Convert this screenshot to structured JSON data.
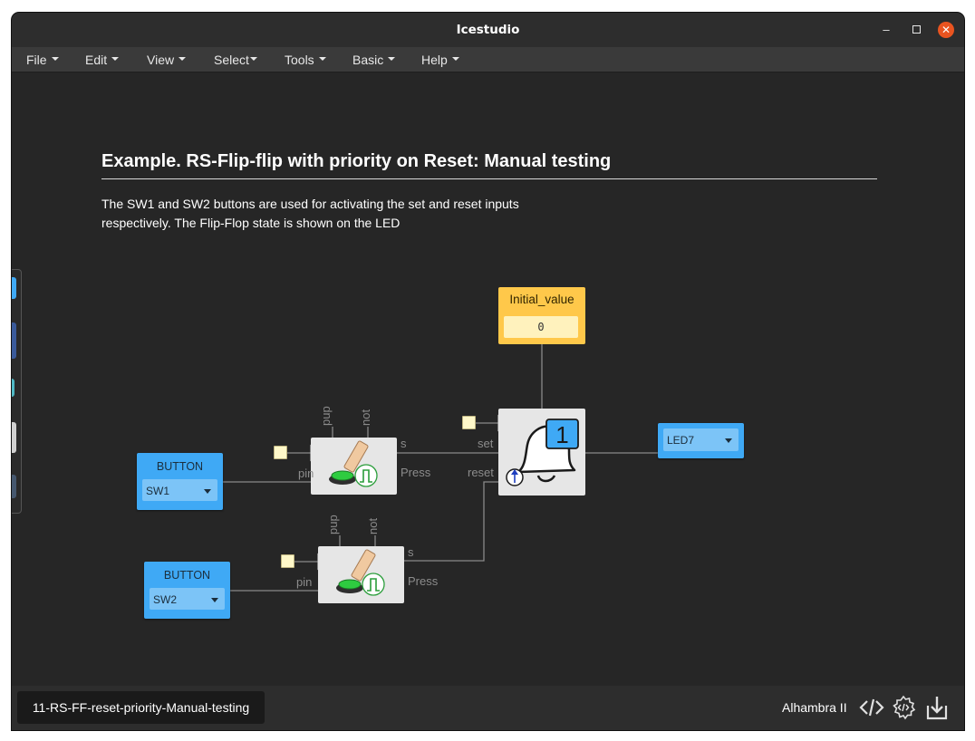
{
  "window": {
    "title": "Icestudio"
  },
  "menubar": {
    "items": [
      {
        "label": "File"
      },
      {
        "label": "Edit"
      },
      {
        "label": "View"
      },
      {
        "label": "Select"
      },
      {
        "label": "Tools"
      },
      {
        "label": "Basic"
      },
      {
        "label": "Help"
      }
    ]
  },
  "document": {
    "heading": "Example. RS-Flip-flip with priority on Reset: Manual testing",
    "description_line1": "The SW1 and SW2 buttons are used for activating the set and reset inputs",
    "description_line2": "respectively. The Flip-Flop state is shown on the LED"
  },
  "blocks": {
    "button1": {
      "title": "BUTTON",
      "pin": "SW1"
    },
    "button2": {
      "title": "BUTTON",
      "pin": "SW2"
    },
    "led": {
      "pin": "LED7"
    },
    "constant": {
      "title": "Initial_value",
      "value": "0"
    },
    "flipflop": {
      "badge": "1",
      "in_set": "set",
      "in_reset": "reset"
    },
    "filter1": {
      "in_pin": "pin",
      "out_s": "s",
      "out_press": "Press",
      "top_pup": "pup",
      "top_not": "not"
    },
    "filter2": {
      "in_pin": "pin",
      "out_s": "s",
      "out_press": "Press",
      "top_pup": "pup",
      "top_not": "not"
    }
  },
  "statusbar": {
    "file_name": "11-RS-FF-reset-priority-Manual-testing",
    "board": "Alhambra II"
  },
  "colors": {
    "io_block": "#3fa9f5",
    "constant_block": "#ffc84a",
    "logic_block": "#e6e6e6",
    "close_button": "#e95420",
    "canvas": "#262626"
  }
}
